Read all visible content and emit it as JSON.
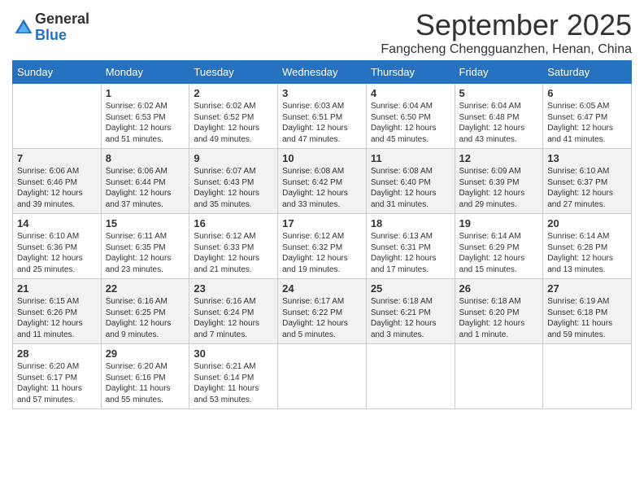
{
  "logo": {
    "general": "General",
    "blue": "Blue"
  },
  "title": "September 2025",
  "location": "Fangcheng Chengguanzhen, Henan, China",
  "days_of_week": [
    "Sunday",
    "Monday",
    "Tuesday",
    "Wednesday",
    "Thursday",
    "Friday",
    "Saturday"
  ],
  "weeks": [
    [
      {
        "day": "",
        "sunrise": "",
        "sunset": "",
        "daylight": ""
      },
      {
        "day": "1",
        "sunrise": "Sunrise: 6:02 AM",
        "sunset": "Sunset: 6:53 PM",
        "daylight": "Daylight: 12 hours and 51 minutes."
      },
      {
        "day": "2",
        "sunrise": "Sunrise: 6:02 AM",
        "sunset": "Sunset: 6:52 PM",
        "daylight": "Daylight: 12 hours and 49 minutes."
      },
      {
        "day": "3",
        "sunrise": "Sunrise: 6:03 AM",
        "sunset": "Sunset: 6:51 PM",
        "daylight": "Daylight: 12 hours and 47 minutes."
      },
      {
        "day": "4",
        "sunrise": "Sunrise: 6:04 AM",
        "sunset": "Sunset: 6:50 PM",
        "daylight": "Daylight: 12 hours and 45 minutes."
      },
      {
        "day": "5",
        "sunrise": "Sunrise: 6:04 AM",
        "sunset": "Sunset: 6:48 PM",
        "daylight": "Daylight: 12 hours and 43 minutes."
      },
      {
        "day": "6",
        "sunrise": "Sunrise: 6:05 AM",
        "sunset": "Sunset: 6:47 PM",
        "daylight": "Daylight: 12 hours and 41 minutes."
      }
    ],
    [
      {
        "day": "7",
        "sunrise": "Sunrise: 6:06 AM",
        "sunset": "Sunset: 6:46 PM",
        "daylight": "Daylight: 12 hours and 39 minutes."
      },
      {
        "day": "8",
        "sunrise": "Sunrise: 6:06 AM",
        "sunset": "Sunset: 6:44 PM",
        "daylight": "Daylight: 12 hours and 37 minutes."
      },
      {
        "day": "9",
        "sunrise": "Sunrise: 6:07 AM",
        "sunset": "Sunset: 6:43 PM",
        "daylight": "Daylight: 12 hours and 35 minutes."
      },
      {
        "day": "10",
        "sunrise": "Sunrise: 6:08 AM",
        "sunset": "Sunset: 6:42 PM",
        "daylight": "Daylight: 12 hours and 33 minutes."
      },
      {
        "day": "11",
        "sunrise": "Sunrise: 6:08 AM",
        "sunset": "Sunset: 6:40 PM",
        "daylight": "Daylight: 12 hours and 31 minutes."
      },
      {
        "day": "12",
        "sunrise": "Sunrise: 6:09 AM",
        "sunset": "Sunset: 6:39 PM",
        "daylight": "Daylight: 12 hours and 29 minutes."
      },
      {
        "day": "13",
        "sunrise": "Sunrise: 6:10 AM",
        "sunset": "Sunset: 6:37 PM",
        "daylight": "Daylight: 12 hours and 27 minutes."
      }
    ],
    [
      {
        "day": "14",
        "sunrise": "Sunrise: 6:10 AM",
        "sunset": "Sunset: 6:36 PM",
        "daylight": "Daylight: 12 hours and 25 minutes."
      },
      {
        "day": "15",
        "sunrise": "Sunrise: 6:11 AM",
        "sunset": "Sunset: 6:35 PM",
        "daylight": "Daylight: 12 hours and 23 minutes."
      },
      {
        "day": "16",
        "sunrise": "Sunrise: 6:12 AM",
        "sunset": "Sunset: 6:33 PM",
        "daylight": "Daylight: 12 hours and 21 minutes."
      },
      {
        "day": "17",
        "sunrise": "Sunrise: 6:12 AM",
        "sunset": "Sunset: 6:32 PM",
        "daylight": "Daylight: 12 hours and 19 minutes."
      },
      {
        "day": "18",
        "sunrise": "Sunrise: 6:13 AM",
        "sunset": "Sunset: 6:31 PM",
        "daylight": "Daylight: 12 hours and 17 minutes."
      },
      {
        "day": "19",
        "sunrise": "Sunrise: 6:14 AM",
        "sunset": "Sunset: 6:29 PM",
        "daylight": "Daylight: 12 hours and 15 minutes."
      },
      {
        "day": "20",
        "sunrise": "Sunrise: 6:14 AM",
        "sunset": "Sunset: 6:28 PM",
        "daylight": "Daylight: 12 hours and 13 minutes."
      }
    ],
    [
      {
        "day": "21",
        "sunrise": "Sunrise: 6:15 AM",
        "sunset": "Sunset: 6:26 PM",
        "daylight": "Daylight: 12 hours and 11 minutes."
      },
      {
        "day": "22",
        "sunrise": "Sunrise: 6:16 AM",
        "sunset": "Sunset: 6:25 PM",
        "daylight": "Daylight: 12 hours and 9 minutes."
      },
      {
        "day": "23",
        "sunrise": "Sunrise: 6:16 AM",
        "sunset": "Sunset: 6:24 PM",
        "daylight": "Daylight: 12 hours and 7 minutes."
      },
      {
        "day": "24",
        "sunrise": "Sunrise: 6:17 AM",
        "sunset": "Sunset: 6:22 PM",
        "daylight": "Daylight: 12 hours and 5 minutes."
      },
      {
        "day": "25",
        "sunrise": "Sunrise: 6:18 AM",
        "sunset": "Sunset: 6:21 PM",
        "daylight": "Daylight: 12 hours and 3 minutes."
      },
      {
        "day": "26",
        "sunrise": "Sunrise: 6:18 AM",
        "sunset": "Sunset: 6:20 PM",
        "daylight": "Daylight: 12 hours and 1 minute."
      },
      {
        "day": "27",
        "sunrise": "Sunrise: 6:19 AM",
        "sunset": "Sunset: 6:18 PM",
        "daylight": "Daylight: 11 hours and 59 minutes."
      }
    ],
    [
      {
        "day": "28",
        "sunrise": "Sunrise: 6:20 AM",
        "sunset": "Sunset: 6:17 PM",
        "daylight": "Daylight: 11 hours and 57 minutes."
      },
      {
        "day": "29",
        "sunrise": "Sunrise: 6:20 AM",
        "sunset": "Sunset: 6:16 PM",
        "daylight": "Daylight: 11 hours and 55 minutes."
      },
      {
        "day": "30",
        "sunrise": "Sunrise: 6:21 AM",
        "sunset": "Sunset: 6:14 PM",
        "daylight": "Daylight: 11 hours and 53 minutes."
      },
      {
        "day": "",
        "sunrise": "",
        "sunset": "",
        "daylight": ""
      },
      {
        "day": "",
        "sunrise": "",
        "sunset": "",
        "daylight": ""
      },
      {
        "day": "",
        "sunrise": "",
        "sunset": "",
        "daylight": ""
      },
      {
        "day": "",
        "sunrise": "",
        "sunset": "",
        "daylight": ""
      }
    ]
  ]
}
